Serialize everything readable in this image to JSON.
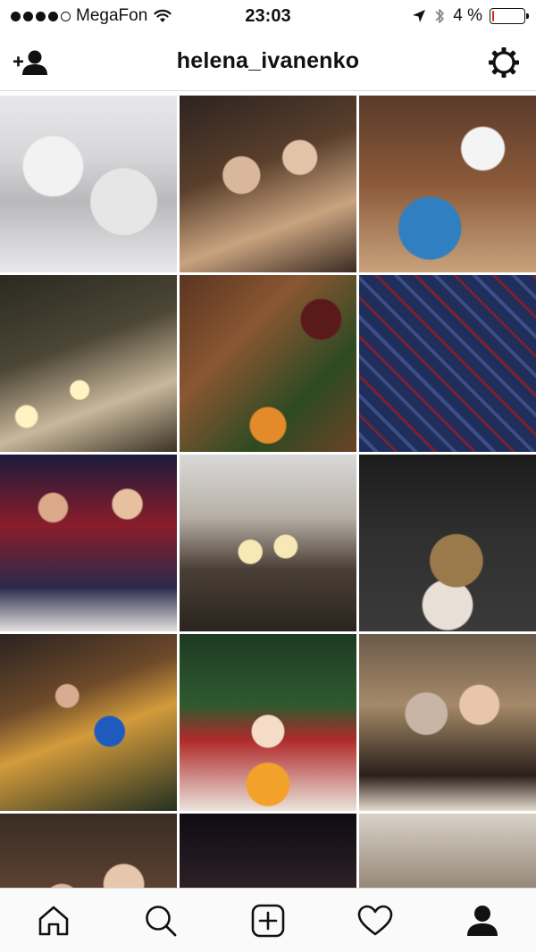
{
  "status_bar": {
    "carrier": "MegaFon",
    "time": "23:03",
    "battery_percent": "4 %",
    "battery_level": 0.04,
    "signal_bars": 5,
    "signal_filled": 4,
    "icons": [
      "wifi-icon",
      "location-arrow-icon",
      "bluetooth-icon",
      "battery-icon"
    ]
  },
  "header": {
    "username": "helena_ivanenko",
    "left_icon": "add-person-icon",
    "right_icon": "settings-gear-icon"
  },
  "grid": {
    "photos": [
      {
        "name": "photo-snowy-trees"
      },
      {
        "name": "photo-family-christmas-tree"
      },
      {
        "name": "photo-baby-toy-car"
      },
      {
        "name": "photo-couple-sparklers"
      },
      {
        "name": "photo-christmas-spices-flatlay"
      },
      {
        "name": "photo-baby-plaid-blanket"
      },
      {
        "name": "photo-friends-party"
      },
      {
        "name": "photo-champagne-table"
      },
      {
        "name": "photo-drink-jar-car"
      },
      {
        "name": "photo-couple-christmas-market"
      },
      {
        "name": "photo-baby-tangerines"
      },
      {
        "name": "photo-friends-selfie"
      },
      {
        "name": "photo-couple-close"
      },
      {
        "name": "photo-night-lights"
      },
      {
        "name": "photo-baby-teddy-bear"
      }
    ]
  },
  "tab_bar": {
    "tabs": [
      {
        "name": "home",
        "icon": "home-icon",
        "active": false
      },
      {
        "name": "search",
        "icon": "search-icon",
        "active": false
      },
      {
        "name": "new-post",
        "icon": "plus-square-icon",
        "active": false
      },
      {
        "name": "activity",
        "icon": "heart-icon",
        "active": false
      },
      {
        "name": "profile",
        "icon": "profile-icon",
        "active": true
      }
    ]
  }
}
